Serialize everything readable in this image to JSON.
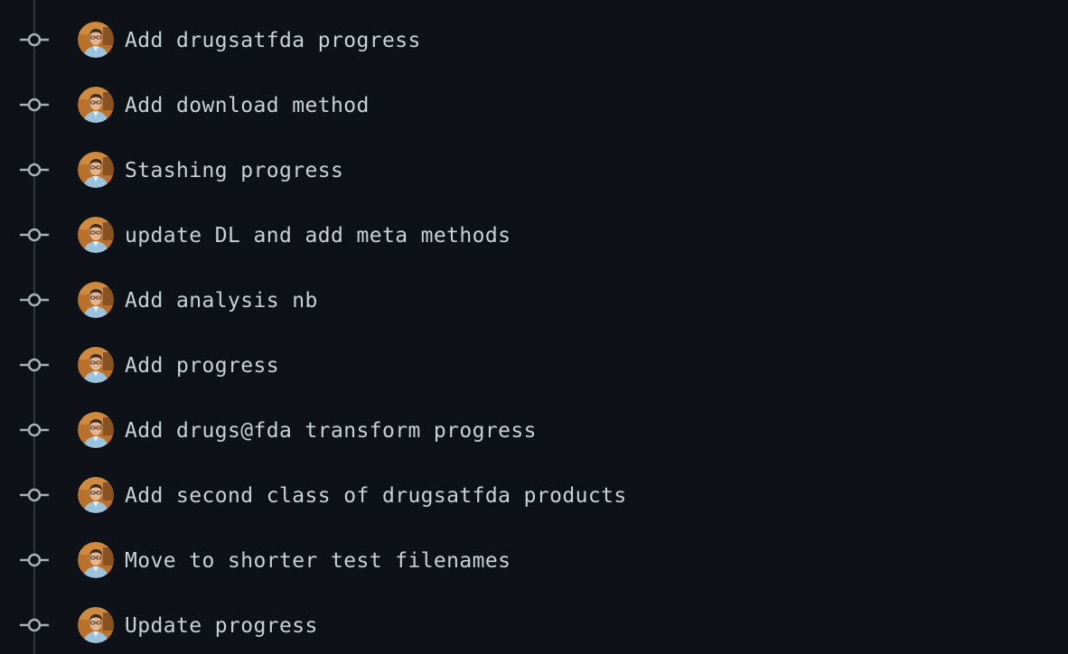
{
  "commits": [
    {
      "message": "Add drugsatfda progress"
    },
    {
      "message": "Add download method"
    },
    {
      "message": "Stashing progress"
    },
    {
      "message": "update DL and add meta methods"
    },
    {
      "message": "Add analysis nb"
    },
    {
      "message": "Add progress"
    },
    {
      "message": "Add drugs@fda transform progress"
    },
    {
      "message": "Add second class of drugsatfda products"
    },
    {
      "message": "Move to shorter test filenames"
    },
    {
      "message": "Update progress"
    }
  ],
  "colors": {
    "background": "#0e1118",
    "line": "#30363d",
    "node": "#a8b0ba",
    "text": "#c9d1d9"
  },
  "icons": {
    "commit": "git-commit-icon",
    "avatar": "user-avatar"
  }
}
